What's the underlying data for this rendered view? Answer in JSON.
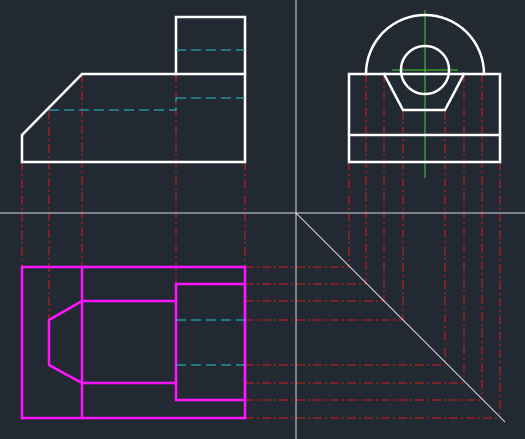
{
  "colors": {
    "background": "#222933",
    "visible_edge": "#ffffff",
    "hidden_line": "#1fc6d6",
    "projection_line": "#d01c1c",
    "center_line": "#4ad12a",
    "top_view_edge": "#ff14ff",
    "axis_cross": "#d7dbe0"
  },
  "views": [
    "front-view",
    "side-view",
    "top-view"
  ]
}
